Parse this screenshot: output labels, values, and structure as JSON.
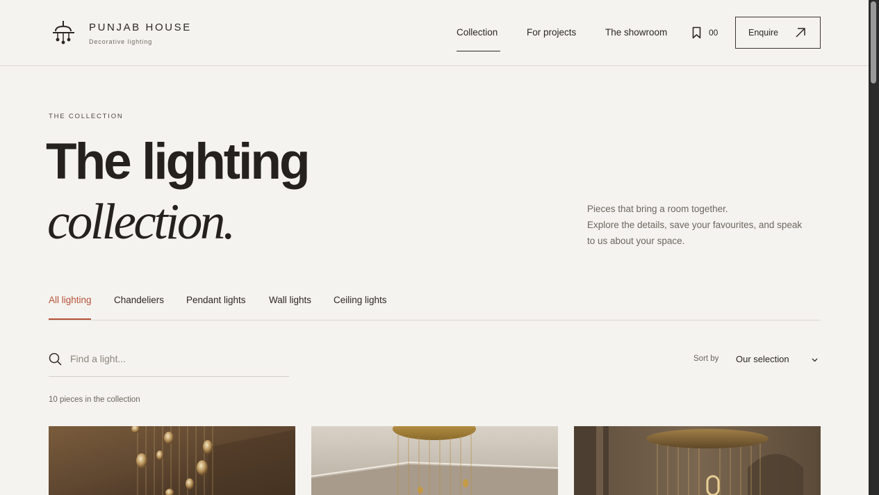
{
  "brand": {
    "name": "PUNJAB HOUSE",
    "tagline": "Decorative lighting"
  },
  "nav": {
    "items": [
      {
        "label": "Collection",
        "active": true
      },
      {
        "label": "For projects",
        "active": false
      },
      {
        "label": "The showroom",
        "active": false
      }
    ],
    "saved_count": "00",
    "enquire_label": "Enquire"
  },
  "hero": {
    "eyebrow": "THE COLLECTION",
    "title_line1": "The lighting",
    "title_line2": "collection.",
    "intro_lines": [
      "Pieces that bring a room together.",
      "Explore the details, save your favourites, and speak",
      "to us about your space."
    ]
  },
  "tabs": [
    {
      "label": "All lighting",
      "active": true
    },
    {
      "label": "Chandeliers",
      "active": false
    },
    {
      "label": "Pendant lights",
      "active": false
    },
    {
      "label": "Wall lights",
      "active": false
    },
    {
      "label": "Ceiling lights",
      "active": false
    }
  ],
  "search": {
    "placeholder": "Find a light...",
    "value": ""
  },
  "sort": {
    "label": "Sort by",
    "selected": "Our selection"
  },
  "results": {
    "count_text": "10 pieces in the collection"
  },
  "colors": {
    "background": "#f5f3ef",
    "text": "#2a2724",
    "accent": "#b5533a",
    "muted": "#6b6660",
    "divider": "#dcd8d1"
  },
  "icons": {
    "logo": "chandelier-logo-icon",
    "saved": "bookmark-icon",
    "enquire": "arrow-up-right-icon",
    "search": "search-icon",
    "sort": "chevron-down-icon"
  }
}
